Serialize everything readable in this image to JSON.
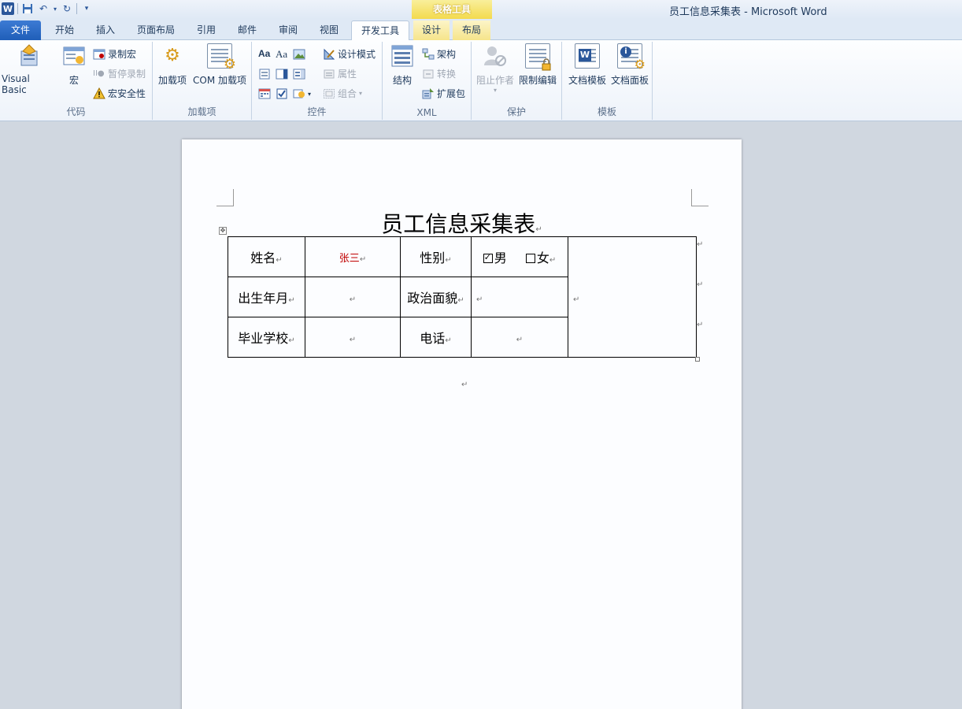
{
  "window": {
    "title": "员工信息采集表 - Microsoft Word",
    "context_tab_group": "表格工具"
  },
  "quick_access": {
    "app_icon": "W",
    "items": [
      "save-icon",
      "undo-icon",
      "redo-icon",
      "customize-icon"
    ]
  },
  "tabs": [
    "文件",
    "开始",
    "插入",
    "页面布局",
    "引用",
    "邮件",
    "审阅",
    "视图",
    "开发工具",
    "设计",
    "布局"
  ],
  "active_tab": "开发工具",
  "ribbon": {
    "code": {
      "label": "代码",
      "visual_basic": "Visual Basic",
      "macros": "宏",
      "record_macro": "录制宏",
      "pause_recording": "暂停录制",
      "macro_security": "宏安全性"
    },
    "addins": {
      "label": "加载项",
      "addins": "加载项",
      "com_addins": "COM 加载项"
    },
    "controls": {
      "label": "控件",
      "rich_text": "Aa",
      "plain_text": "Aa",
      "design_mode": "设计模式",
      "properties": "属性",
      "group": "组合"
    },
    "xml": {
      "label": "XML",
      "structure": "结构",
      "schema": "架构",
      "transform": "转换",
      "expansion_pack": "扩展包"
    },
    "protect": {
      "label": "保护",
      "block_authors": "阻止作者",
      "restrict_editing": "限制编辑"
    },
    "templates": {
      "label": "模板",
      "document_template": "文档模板",
      "document_panel": "文档面板"
    }
  },
  "document": {
    "title": "员工信息采集表",
    "paragraph_mark": "↵",
    "table": {
      "name_label": "姓名",
      "name_value": "张三",
      "gender_label": "性别",
      "gender_male": "男",
      "gender_female": "女",
      "gender_male_checked": true,
      "gender_female_checked": false,
      "birth_label": "出生年月",
      "politics_label": "政治面貌",
      "school_label": "毕业学校",
      "phone_label": "电话"
    }
  },
  "colors": {
    "file_tab": "#2b579a",
    "context_tab": "#f3da4e",
    "name_value": "#c00000"
  }
}
